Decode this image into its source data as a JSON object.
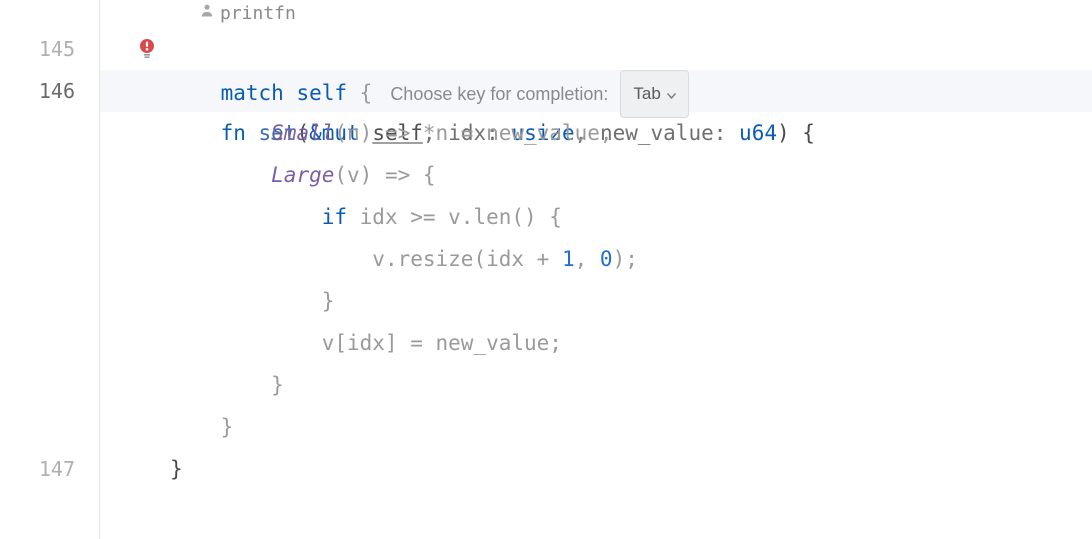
{
  "inlay": {
    "author_label": "printfn",
    "author_icon": "person-icon"
  },
  "gutter": {
    "l145": "145",
    "l146": "146",
    "l147": "147"
  },
  "hint": {
    "text": "Choose key for completion:",
    "key": "Tab"
  },
  "code": {
    "fn_kw": "fn ",
    "fn_name": "set",
    "sig_open": "(",
    "mut_kw": "&mut ",
    "self_kw": "self",
    "comma1": ", ",
    "p1_name": "idx",
    "p1_colon": ": ",
    "p1_type": "usize",
    "comma2": ", ",
    "p2_name": "new_value",
    "p2_colon": ": ",
    "p2_type": "u64",
    "sig_close": ") {",
    "match_kw": "match ",
    "match_self": "self",
    "match_open": " {",
    "small": "Small",
    "small_rest": "(n) => *n = new_value,",
    "large": "Large",
    "large_rest": "(v) => {",
    "if_kw": "if ",
    "if_cond": "idx >= v.len() {",
    "resize_call": "v.resize(idx + ",
    "resize_one": "1",
    "resize_mid": ", ",
    "resize_zero": "0",
    "resize_end": ");",
    "brace_close1": "}",
    "assign": "v[idx] = new_value;",
    "brace_close2": "}",
    "brace_close3": "}",
    "brace_close4": "}"
  }
}
